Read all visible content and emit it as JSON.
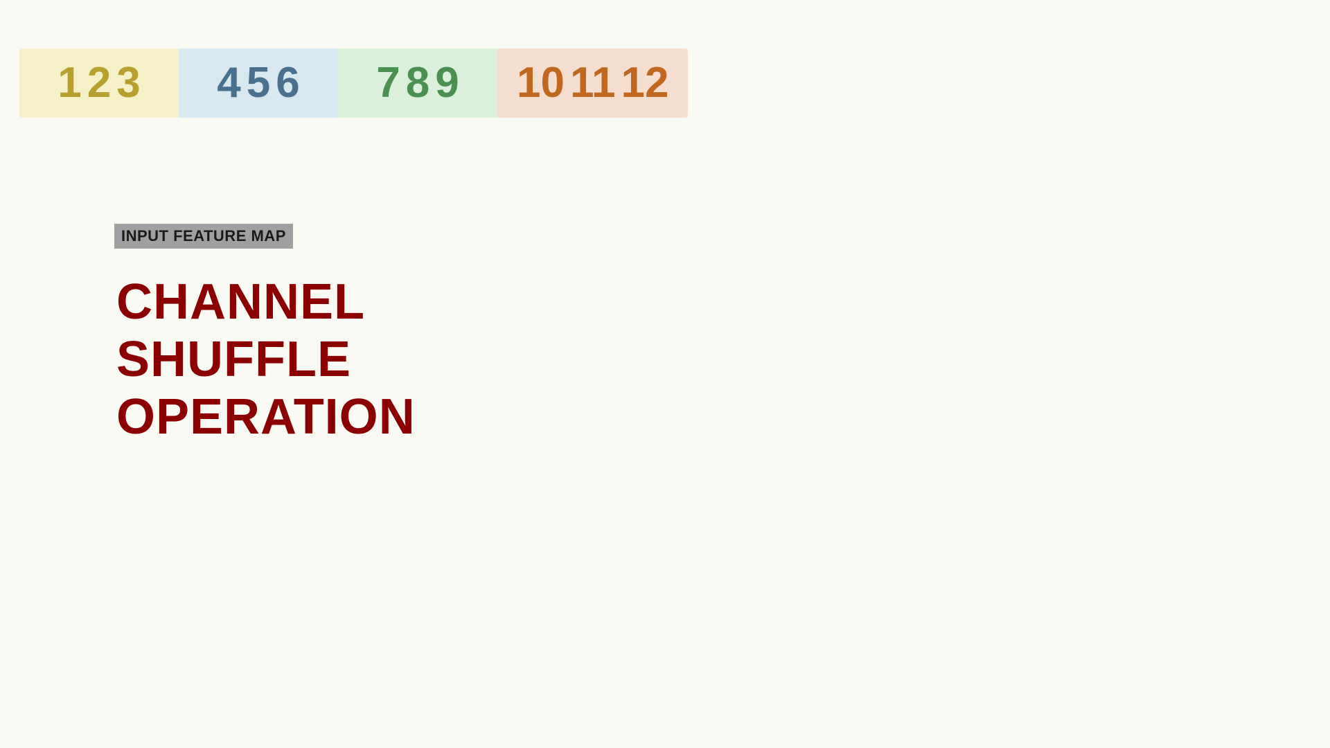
{
  "page": {
    "background": "#fafaf5"
  },
  "channel_bar": {
    "groups": [
      {
        "id": "group-1",
        "bg_color": "#f5f0c8",
        "numbers": [
          "1",
          "2",
          "3"
        ],
        "color": "#b8a030",
        "color_class": "num-yellow"
      },
      {
        "id": "group-2",
        "bg_color": "#d8e8f0",
        "numbers": [
          "4",
          "5",
          "6"
        ],
        "color": "#4a7090",
        "color_class": "num-blue"
      },
      {
        "id": "group-3",
        "bg_color": "#daf0da",
        "numbers": [
          "7",
          "8",
          "9"
        ],
        "color": "#4a9050",
        "color_class": "num-green"
      },
      {
        "id": "group-4",
        "bg_color": "#f5ddd0",
        "numbers": [
          "10",
          "11",
          "12"
        ],
        "color": "#c06820",
        "color_class": "num-orange"
      }
    ]
  },
  "input_feature_label": "INPUT FEATURE MAP",
  "main_text": {
    "line1": "CHANNEL",
    "line2": "SHUFFLE",
    "line3": "OPERATION"
  }
}
